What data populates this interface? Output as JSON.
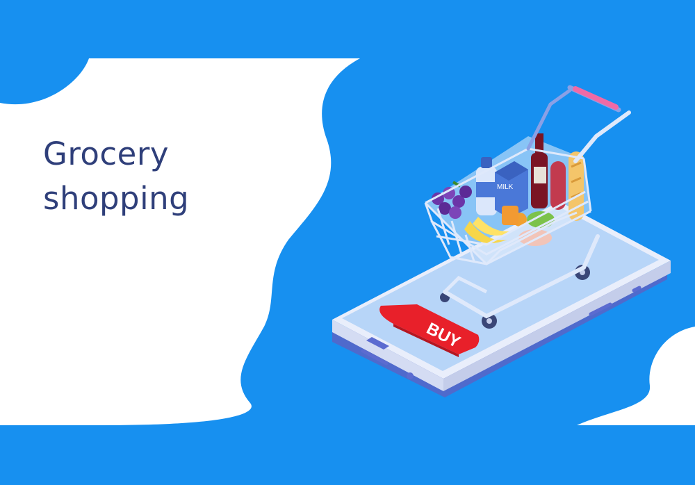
{
  "headline": {
    "line1": "Grocery",
    "line2": "shopping"
  },
  "buy_button": {
    "label": "BUY"
  },
  "carton_label": "MILK",
  "colors": {
    "background_blue": "#1790f0",
    "panel_white": "#ffffff",
    "headline_text": "#2f3f7a",
    "buy_button_red": "#e8202a",
    "cart_frame": "#dfe9fb",
    "cart_handle": "#f06aa6",
    "phone_screen": "#b7d5f8"
  },
  "icons": [
    "shopping-cart-icon",
    "smartphone-icon"
  ]
}
